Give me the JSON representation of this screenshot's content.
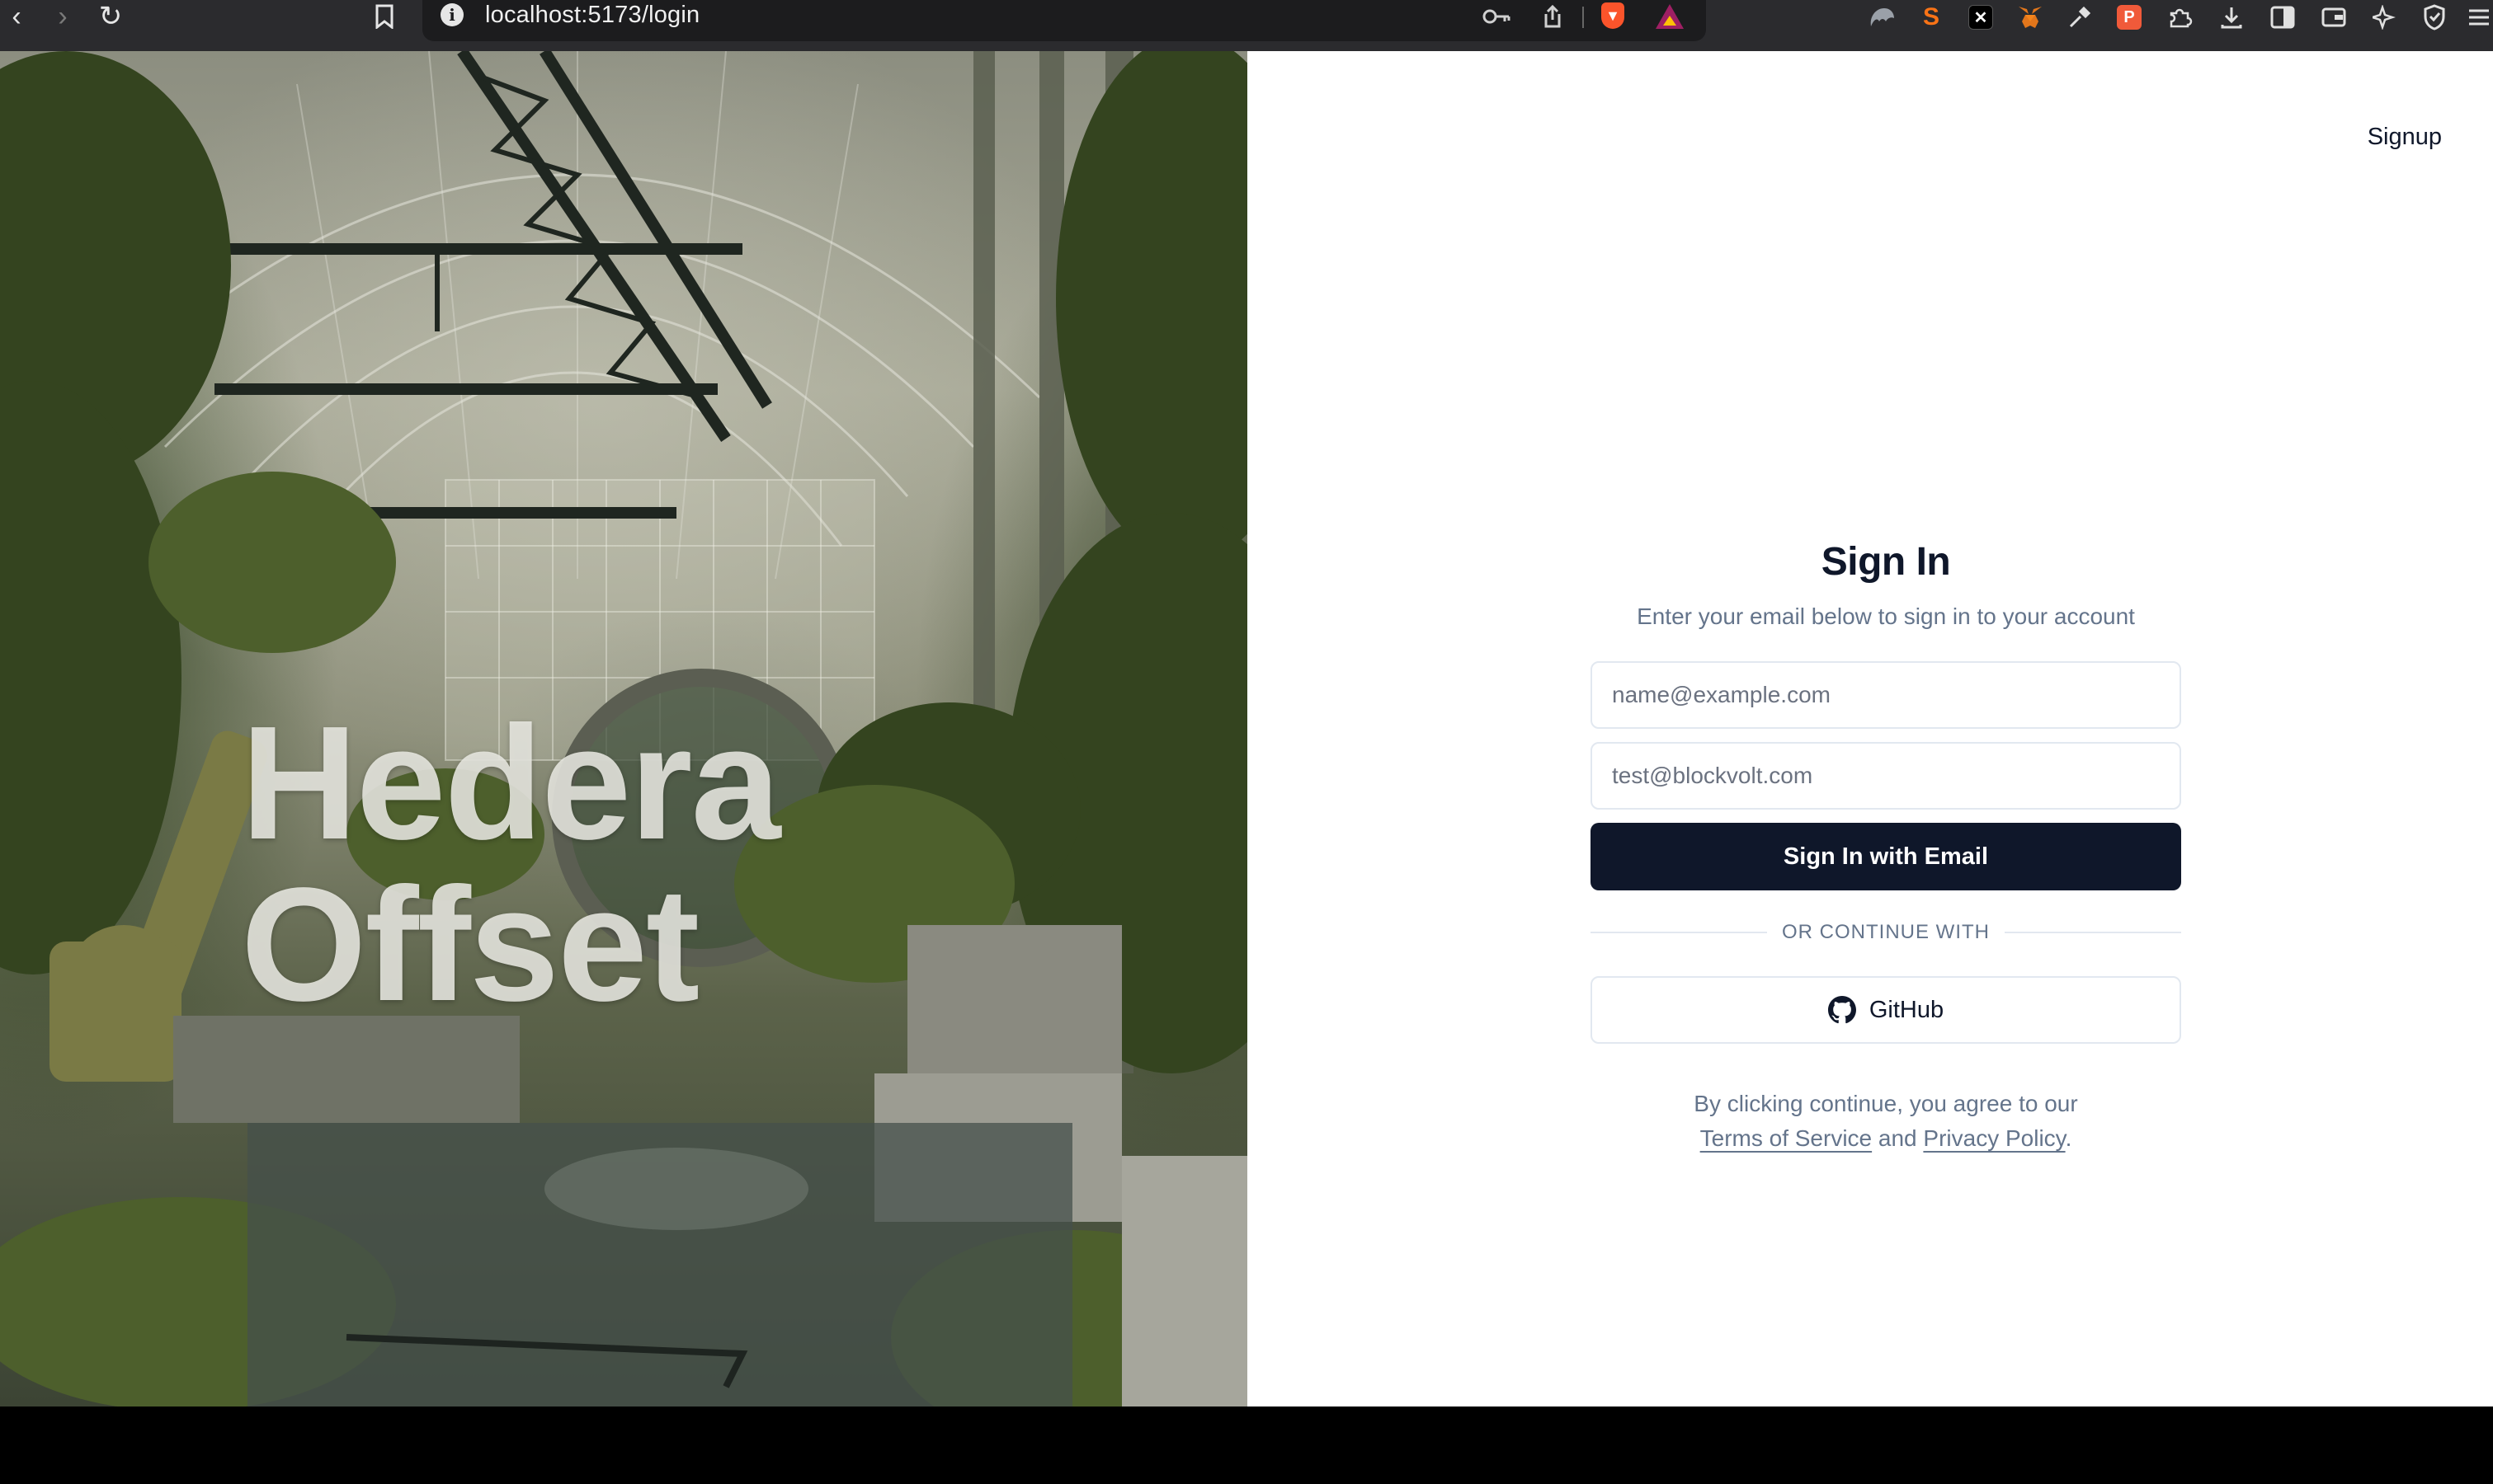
{
  "browser": {
    "url": "localhost:5173/login",
    "extensions": [
      "ghost-extension-icon",
      "s-extension-icon",
      "x-extension-icon",
      "metamask-fox-icon",
      "eyedropper-icon",
      "p-extension-icon",
      "puzzle-icon",
      "download-icon",
      "sidebar-icon",
      "wallet-icon",
      "sparkle-icon",
      "shield-icon",
      "menu-icon"
    ]
  },
  "hero": {
    "title_line1": "Hedera",
    "title_line2": "Offset"
  },
  "auth": {
    "signup_label": "Signup",
    "title": "Sign In",
    "subtitle": "Enter your email below to sign in to your account",
    "email_placeholder": "name@example.com",
    "password_placeholder": "test@blockvolt.com",
    "submit_label": "Sign In with Email",
    "divider_label": "OR CONTINUE WITH",
    "github_label": "GitHub",
    "legal_prefix": "By clicking continue, you agree to our",
    "terms_label": "Terms of Service",
    "legal_and": "and",
    "privacy_label": "Privacy Policy",
    "legal_suffix": "."
  },
  "colors": {
    "primary": "#0f172a",
    "muted_text": "#64748b",
    "border": "#e2e8f0",
    "browser_bar": "#2b2b2e"
  }
}
